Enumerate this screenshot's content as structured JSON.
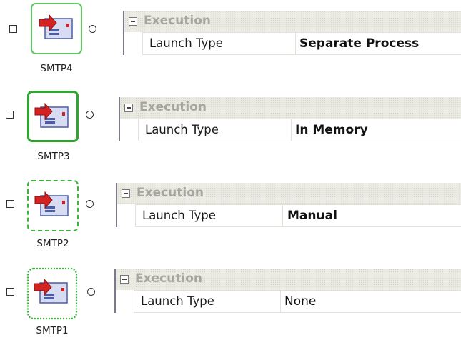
{
  "components": [
    {
      "name": "SMTP4",
      "border_style": "solid-thin",
      "border_color": "#5ec85e",
      "category": "Execution",
      "property_name": "Launch Type",
      "property_value": "Separate Process",
      "value_bold": true
    },
    {
      "name": "SMTP3",
      "border_style": "solid-thick",
      "border_color": "#2fa62f",
      "category": "Execution",
      "property_name": "Launch Type",
      "property_value": "In Memory",
      "value_bold": true
    },
    {
      "name": "SMTP2",
      "border_style": "dashed",
      "border_color": "#3cb43c",
      "category": "Execution",
      "property_name": "Launch Type",
      "property_value": "Manual",
      "value_bold": true
    },
    {
      "name": "SMTP1",
      "border_style": "wavy",
      "border_color": "#3cb43c",
      "category": "Execution",
      "property_name": "Launch Type",
      "property_value": "None",
      "value_bold": false
    }
  ],
  "icons": {
    "node": "email-send-icon",
    "toggle": "collapse-minus-icon",
    "left_port": "input-checkbox-icon",
    "right_port": "output-port-icon"
  }
}
